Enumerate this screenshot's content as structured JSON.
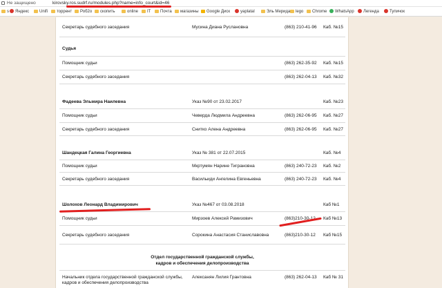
{
  "browser": {
    "not_secure": "Не защищено",
    "url": "kirovsky.ros.sudrf.ru/modules.php?name=info_court&id=46",
    "bookmarks": [
      {
        "label": "s",
        "icon": "folder"
      },
      {
        "label": "Яндекс",
        "icon": "yandex"
      },
      {
        "label": "Unifi",
        "icon": "folder"
      },
      {
        "label": "торрент",
        "icon": "folder"
      },
      {
        "label": "Роб2о",
        "icon": "folder"
      },
      {
        "label": "скопить",
        "icon": "folder"
      },
      {
        "label": "online",
        "icon": "folder"
      },
      {
        "label": "IT",
        "icon": "folder"
      },
      {
        "label": "Почта",
        "icon": "folder"
      },
      {
        "label": "магазины",
        "icon": "folder"
      },
      {
        "label": "Google Диск",
        "icon": "drive"
      },
      {
        "label": "yaplatal",
        "icon": "red"
      },
      {
        "label": "Эль Мерида",
        "icon": "folder"
      },
      {
        "label": "lego",
        "icon": "folder"
      },
      {
        "label": "Chrome",
        "icon": "folder"
      },
      {
        "label": "WhatsApp",
        "icon": "whatsapp"
      },
      {
        "label": "Легенда",
        "icon": "red"
      },
      {
        "label": "Тупичок",
        "icon": "red"
      }
    ]
  },
  "rows": [
    {
      "kind": "row",
      "name": "Секретарь судебного заседания",
      "person": "Мусина Диана Руслановна",
      "phone": "(863) 210-41-96",
      "room": "Каб. №15"
    },
    {
      "kind": "head",
      "name": "Судья",
      "person": "",
      "phone": "",
      "room": ""
    },
    {
      "kind": "row",
      "name": "Помощник судьи",
      "person": "",
      "phone": "(863) 262-35-92",
      "room": "Каб. №15"
    },
    {
      "kind": "row",
      "name": "Секретарь судебного заседания",
      "person": "",
      "phone": "(863) 262-04-13",
      "room": "Каб. №32"
    },
    {
      "kind": "head",
      "name": "Фадеева Эльмира Наилевна",
      "person": "Указ №90 от 23.02.2017",
      "phone": "",
      "room": "Каб. №23"
    },
    {
      "kind": "row",
      "name": "Помощник судьи",
      "person": "Чеверда Людмила Андреевна",
      "phone": "(863) 262-06-95",
      "room": "Каб. №27"
    },
    {
      "kind": "row",
      "name": "Секретарь судебного заседания",
      "person": "Снитко Алена Андреевна",
      "phone": "(863) 262-06-95",
      "room": "Каб. №27"
    },
    {
      "kind": "head",
      "name": "Шандецкая Галина Георгиевна",
      "person": "Указ № 381 от 22.07.2015",
      "phone": "",
      "room": "Каб. №4"
    },
    {
      "kind": "row",
      "name": "Помощник судьи",
      "person": "Мкртумян Нарине Тиграновна",
      "phone": "(863) 240-72-23",
      "room": "Каб. №2"
    },
    {
      "kind": "row",
      "name": "Секретарь судебного заседания",
      "person": "Васильиди Ангелина Евгеньевна",
      "phone": "(863) 240-72-23",
      "room": "Каб. №4"
    },
    {
      "kind": "head",
      "name": "Шолохов Леонард Владимирович",
      "person": "Указ №467 от 03.08.2018",
      "phone": "",
      "room": "Каб №1"
    },
    {
      "kind": "row",
      "name": "Помощник судьи",
      "person": "Мирзоев Алексей Рамизович",
      "phone": "(863)210-30-12",
      "room": "Каб №13"
    },
    {
      "kind": "row",
      "name": "Секретарь судебного заседания",
      "person": "Сорокина Анастасия Станиславовна",
      "phone": "(863)210-30-12",
      "room": "Каб №15"
    },
    {
      "kind": "section",
      "name": "Отдел государственной гражданской службы,",
      "name2": "кадров и обеспечения делопроизводства"
    },
    {
      "kind": "row2",
      "name": "Начальник отдела государственной гражданской службы,",
      "name2": "кадров и обеспечения делопроизводства",
      "person": "Алексанян Лилия Грантовна",
      "phone": "(863) 262-04-13",
      "room": "Каб № 31"
    }
  ],
  "colors": {
    "annotation": "#e11f1f",
    "page_bg": "#f4ebe0"
  }
}
